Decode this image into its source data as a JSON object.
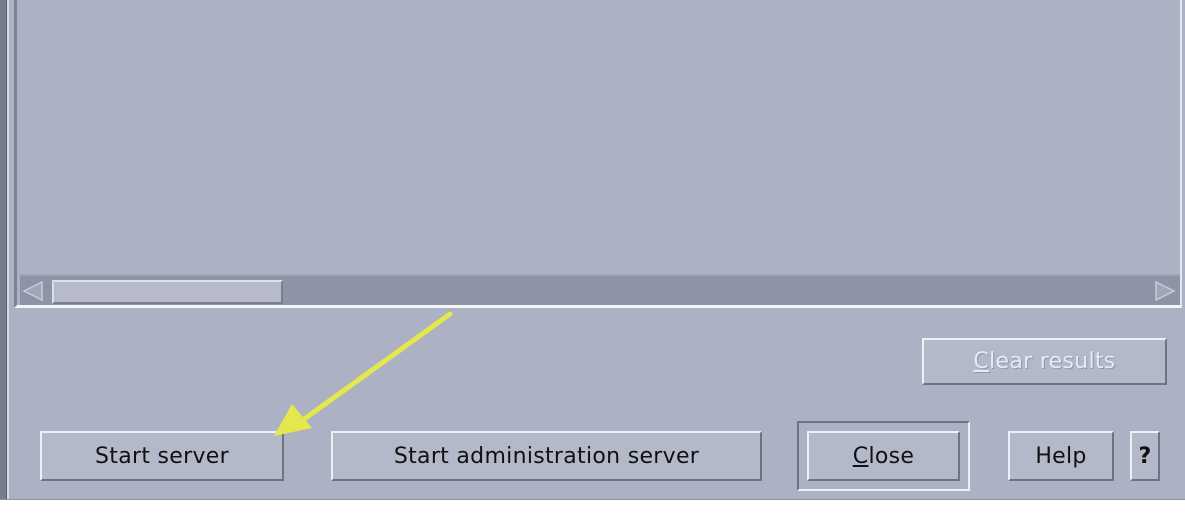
{
  "buttons": {
    "clear_results": {
      "prefix": "",
      "mnemonic": "C",
      "rest": "lear results"
    },
    "start_server": "Start server",
    "start_admin_server": "Start administration server",
    "close": {
      "mnemonic": "C",
      "rest": "lose"
    },
    "help": "Help",
    "context_help": "?"
  },
  "colors": {
    "window_bg": "#acb1c3",
    "annotation_arrow": "#e5e84a"
  },
  "icons": {
    "scroll_left": "triangle-left-icon",
    "scroll_right": "triangle-right-icon",
    "annotation": "yellow-arrow"
  }
}
